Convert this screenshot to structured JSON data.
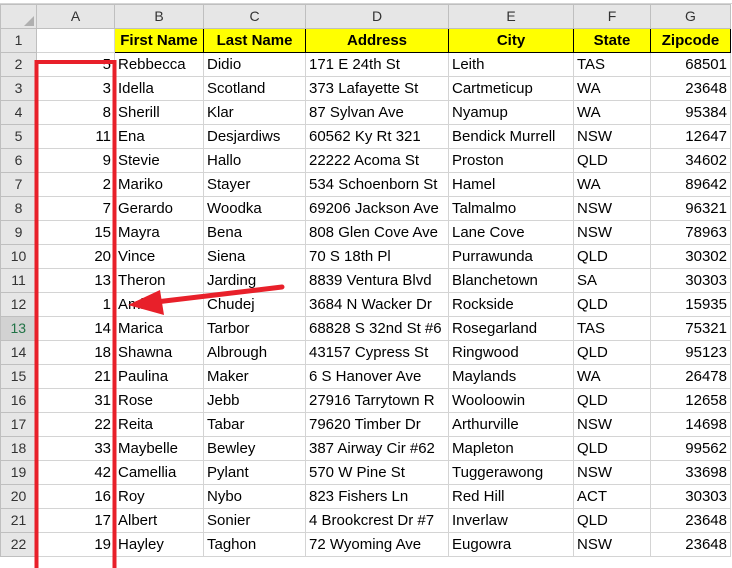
{
  "columns": [
    "A",
    "B",
    "C",
    "D",
    "E",
    "F",
    "G"
  ],
  "header_row": {
    "row_number": "1",
    "cells": [
      "",
      "First Name",
      "Last Name",
      "Address",
      "City",
      "State",
      "Zipcode"
    ]
  },
  "active_row": "13",
  "rows": [
    {
      "n": "2",
      "a": "5",
      "first": "Rebbecca",
      "last": "Didio",
      "address": "171 E 24th St",
      "city": "Leith",
      "state": "TAS",
      "zip": "68501"
    },
    {
      "n": "3",
      "a": "3",
      "first": "Idella",
      "last": "Scotland",
      "address": "373 Lafayette St",
      "city": "Cartmeticup",
      "state": "WA",
      "zip": "23648"
    },
    {
      "n": "4",
      "a": "8",
      "first": "Sherill",
      "last": "Klar",
      "address": "87 Sylvan Ave",
      "city": "Nyamup",
      "state": "WA",
      "zip": "95384"
    },
    {
      "n": "5",
      "a": "11",
      "first": "Ena",
      "last": "Desjardiws",
      "address": "60562 Ky Rt 321",
      "city": "Bendick Murrell",
      "state": "NSW",
      "zip": "12647"
    },
    {
      "n": "6",
      "a": "9",
      "first": "Stevie",
      "last": "Hallo",
      "address": "22222 Acoma St",
      "city": "Proston",
      "state": "QLD",
      "zip": "34602"
    },
    {
      "n": "7",
      "a": "2",
      "first": "Mariko",
      "last": "Stayer",
      "address": "534 Schoenborn St",
      "city": "Hamel",
      "state": "WA",
      "zip": "89642"
    },
    {
      "n": "8",
      "a": "7",
      "first": "Gerardo",
      "last": "Woodka",
      "address": "69206 Jackson Ave",
      "city": "Talmalmo",
      "state": "NSW",
      "zip": "96321"
    },
    {
      "n": "9",
      "a": "15",
      "first": "Mayra",
      "last": "Bena",
      "address": "808 Glen Cove Ave",
      "city": "Lane Cove",
      "state": "NSW",
      "zip": "78963"
    },
    {
      "n": "10",
      "a": "20",
      "first": "Vince",
      "last": "Siena",
      "address": "70 S 18th Pl",
      "city": "Purrawunda",
      "state": "QLD",
      "zip": "30302"
    },
    {
      "n": "11",
      "a": "13",
      "first": "Theron",
      "last": "Jarding",
      "address": "8839 Ventura Blvd",
      "city": "Blanchetown",
      "state": "SA",
      "zip": "30303"
    },
    {
      "n": "12",
      "a": "1",
      "first": "Amira",
      "last": "Chudej",
      "address": "3684 N Wacker Dr",
      "city": "Rockside",
      "state": "QLD",
      "zip": "15935"
    },
    {
      "n": "13",
      "a": "14",
      "first": "Marica",
      "last": "Tarbor",
      "address": "68828 S 32nd St #6",
      "city": "Rosegarland",
      "state": "TAS",
      "zip": "75321"
    },
    {
      "n": "14",
      "a": "18",
      "first": "Shawna",
      "last": "Albrough",
      "address": "43157 Cypress St",
      "city": "Ringwood",
      "state": "QLD",
      "zip": "95123"
    },
    {
      "n": "15",
      "a": "21",
      "first": "Paulina",
      "last": "Maker",
      "address": "6 S Hanover Ave",
      "city": "Maylands",
      "state": "WA",
      "zip": "26478"
    },
    {
      "n": "16",
      "a": "31",
      "first": "Rose",
      "last": "Jebb",
      "address": "27916 Tarrytown R",
      "city": "Wooloowin",
      "state": "QLD",
      "zip": "12658"
    },
    {
      "n": "17",
      "a": "22",
      "first": "Reita",
      "last": "Tabar",
      "address": "79620 Timber Dr",
      "city": "Arthurville",
      "state": "NSW",
      "zip": "14698"
    },
    {
      "n": "18",
      "a": "33",
      "first": "Maybelle",
      "last": "Bewley",
      "address": "387 Airway Cir #62",
      "city": "Mapleton",
      "state": "QLD",
      "zip": "99562"
    },
    {
      "n": "19",
      "a": "42",
      "first": "Camellia",
      "last": "Pylant",
      "address": "570 W Pine St",
      "city": "Tuggerawong",
      "state": "NSW",
      "zip": "33698"
    },
    {
      "n": "20",
      "a": "16",
      "first": "Roy",
      "last": "Nybo",
      "address": "823 Fishers Ln",
      "city": "Red Hill",
      "state": "ACT",
      "zip": "30303"
    },
    {
      "n": "21",
      "a": "17",
      "first": "Albert",
      "last": "Sonier",
      "address": "4 Brookcrest Dr #7",
      "city": "Inverlaw",
      "state": "QLD",
      "zip": "23648"
    },
    {
      "n": "22",
      "a": "19",
      "first": "Hayley",
      "last": "Taghon",
      "address": "72 Wyoming Ave",
      "city": "Eugowra",
      "state": "NSW",
      "zip": "23648"
    }
  ],
  "colors": {
    "header_fill": "#ffff00",
    "annotation_red": "#e8202a",
    "active_row_accent": "#217346",
    "grid_line": "#d4d4d4",
    "heading_fill": "#e6e6e6"
  },
  "annotations": [
    "red-box-column-a",
    "red-arrow"
  ]
}
